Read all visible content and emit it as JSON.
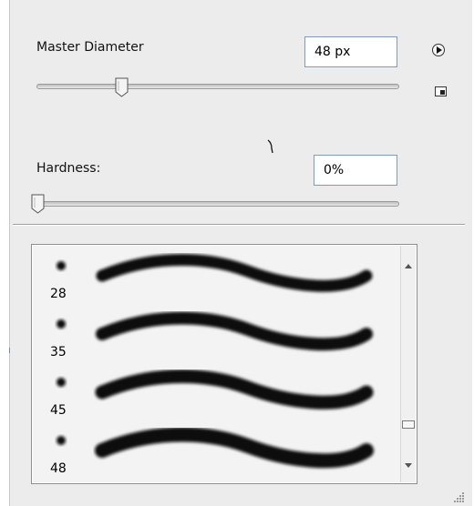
{
  "master_diameter": {
    "label": "Master Diameter",
    "value": "48 px",
    "slider_fraction": 0.24
  },
  "hardness": {
    "label": "Hardness:",
    "value": "0%",
    "slider_fraction": 0.0
  },
  "panel_menu": {
    "icon": "play-circle-icon"
  },
  "new_preset": {
    "icon": "new-preset-icon"
  },
  "brush_presets": {
    "items": [
      {
        "size": "28"
      },
      {
        "size": "35"
      },
      {
        "size": "45"
      },
      {
        "size": "48"
      }
    ]
  },
  "scrollbar": {
    "position_fraction": 0.85
  }
}
